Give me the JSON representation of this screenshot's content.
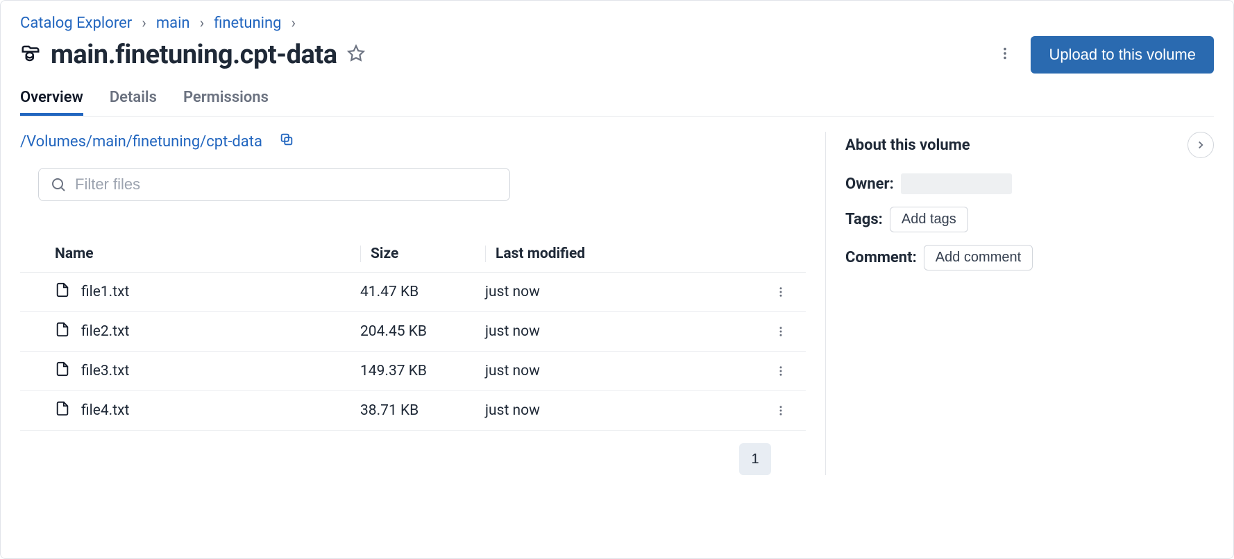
{
  "breadcrumb": {
    "items": [
      "Catalog Explorer",
      "main",
      "finetuning"
    ]
  },
  "header": {
    "title": "main.finetuning.cpt-data",
    "upload_label": "Upload to this volume"
  },
  "tabs": [
    {
      "label": "Overview",
      "active": true
    },
    {
      "label": "Details",
      "active": false
    },
    {
      "label": "Permissions",
      "active": false
    }
  ],
  "path": "/Volumes/main/finetuning/cpt-data",
  "filter": {
    "placeholder": "Filter files"
  },
  "columns": {
    "name": "Name",
    "size": "Size",
    "modified": "Last modified"
  },
  "files": [
    {
      "name": "file1.txt",
      "size": "41.47 KB",
      "modified": "just now"
    },
    {
      "name": "file2.txt",
      "size": "204.45 KB",
      "modified": "just now"
    },
    {
      "name": "file3.txt",
      "size": "149.37 KB",
      "modified": "just now"
    },
    {
      "name": "file4.txt",
      "size": "38.71 KB",
      "modified": "just now"
    }
  ],
  "pagination": {
    "current": "1"
  },
  "about": {
    "title": "About this volume",
    "owner_label": "Owner:",
    "tags_label": "Tags:",
    "tags_button": "Add tags",
    "comment_label": "Comment:",
    "comment_button": "Add comment"
  }
}
